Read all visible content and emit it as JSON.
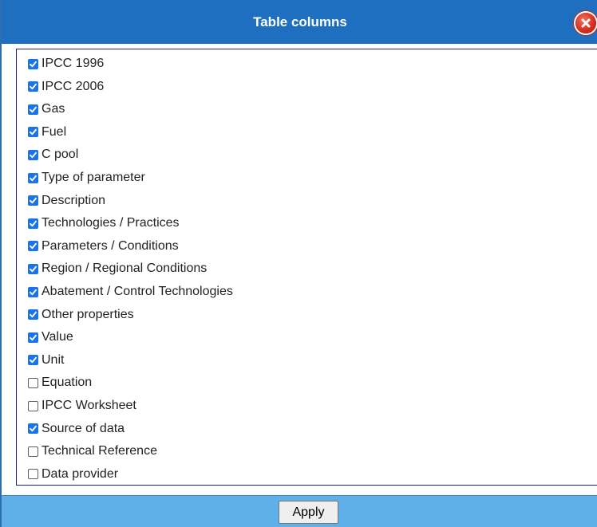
{
  "dialog": {
    "title": "Table columns",
    "apply_label": "Apply"
  },
  "columns": [
    {
      "label": "IPCC 1996",
      "checked": true
    },
    {
      "label": "IPCC 2006",
      "checked": true
    },
    {
      "label": "Gas",
      "checked": true
    },
    {
      "label": "Fuel",
      "checked": true
    },
    {
      "label": "C pool",
      "checked": true
    },
    {
      "label": "Type of parameter",
      "checked": true
    },
    {
      "label": "Description",
      "checked": true
    },
    {
      "label": "Technologies / Practices",
      "checked": true
    },
    {
      "label": "Parameters / Conditions",
      "checked": true
    },
    {
      "label": "Region / Regional Conditions",
      "checked": true
    },
    {
      "label": "Abatement / Control Technologies",
      "checked": true
    },
    {
      "label": "Other properties",
      "checked": true
    },
    {
      "label": "Value",
      "checked": true
    },
    {
      "label": "Unit",
      "checked": true
    },
    {
      "label": "Equation",
      "checked": false
    },
    {
      "label": "IPCC Worksheet",
      "checked": false
    },
    {
      "label": "Source of data",
      "checked": true
    },
    {
      "label": "Technical Reference",
      "checked": false
    },
    {
      "label": "Data provider",
      "checked": false
    }
  ],
  "colors": {
    "titlebar": "#1e6fbf",
    "footer": "#5fb0e8",
    "checkbox_checked": "#1a73e8",
    "close": "#d83020"
  },
  "icons": {
    "close": "close-icon",
    "check": "checkmark-icon"
  }
}
